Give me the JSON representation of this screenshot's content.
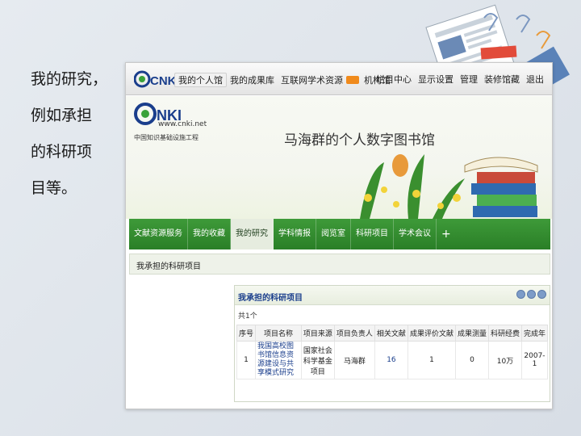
{
  "slide": {
    "lines": [
      "我的研究，",
      "例如承担",
      "的科研项",
      "目等。"
    ]
  },
  "topbar": {
    "logo": "CNKI",
    "nav": [
      {
        "label": "我的个人馆",
        "active": true
      },
      {
        "label": "我的成果库",
        "active": false
      },
      {
        "label": "互联网学术资源",
        "active": false
      },
      {
        "label": "机构馆",
        "active": false
      }
    ],
    "links": [
      "栏目中心",
      "显示设置",
      "管理",
      "装修馆藏",
      "退出"
    ]
  },
  "banner": {
    "logo_text": "CNKI中国知网",
    "url": "www.cnki.net",
    "subtitle": "中国知识基础设施工程",
    "library_title": "马海群的个人数字图书馆"
  },
  "mainnav": {
    "items": [
      {
        "label": "文献资源服务",
        "active": false
      },
      {
        "label": "我的收藏",
        "active": false
      },
      {
        "label": "我的研究",
        "active": true
      },
      {
        "label": "学科情报",
        "active": false
      },
      {
        "label": "阅览室",
        "active": false
      },
      {
        "label": "科研项目",
        "active": false
      },
      {
        "label": "学术会议",
        "active": false
      }
    ],
    "plus": "+"
  },
  "subbar": {
    "text": "我承担的科研项目"
  },
  "panel": {
    "title": "我承担的科研项目",
    "count": "共1个",
    "columns": [
      "序号",
      "项目名称",
      "项目来源",
      "项目负责人",
      "相关文献",
      "成果评价文献",
      "成果测量",
      "科研经费",
      "完成年"
    ],
    "rows": [
      {
        "index": "1",
        "name": "我国高校图书馆信息资源建设与共享模式研究",
        "source": "国家社会科学基金项目",
        "leader": "马海群",
        "docs": "16",
        "eval_docs": "1",
        "measure": "0",
        "funding": "10万",
        "year": "2007-1"
      }
    ]
  },
  "colors": {
    "nav_green": "#2a7f27",
    "link_blue": "#1a3e8c",
    "badge_orange": "#f08a1c"
  }
}
